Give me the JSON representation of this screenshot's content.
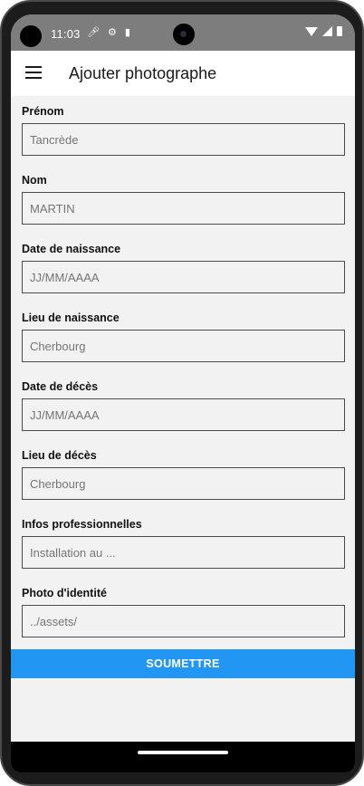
{
  "status_bar": {
    "time": "11:03",
    "left_icons": [
      "mic-icon",
      "settings-icon",
      "sd-card-icon"
    ],
    "right_icons": [
      "wifi-icon",
      "signal-icon",
      "battery-icon"
    ]
  },
  "app_bar": {
    "title": "Ajouter photographe",
    "menu_icon": "hamburger-menu-icon"
  },
  "form": {
    "fields": [
      {
        "label": "Prénom",
        "placeholder": "Tancrède"
      },
      {
        "label": "Nom",
        "placeholder": "MARTIN"
      },
      {
        "label": "Date de naissance",
        "placeholder": "JJ/MM/AAAA"
      },
      {
        "label": "Lieu de naissance",
        "placeholder": "Cherbourg"
      },
      {
        "label": "Date de décès",
        "placeholder": "JJ/MM/AAAA"
      },
      {
        "label": "Lieu de décès",
        "placeholder": "Cherbourg"
      },
      {
        "label": "Infos professionnelles",
        "placeholder": "Installation au ..."
      },
      {
        "label": "Photo d'identité",
        "placeholder": "../assets/"
      }
    ],
    "submit_label": "SOUMETTRE"
  },
  "colors": {
    "accent": "#2196f3",
    "status_bar": "#7d7d7d",
    "background": "#f2f2f2"
  }
}
